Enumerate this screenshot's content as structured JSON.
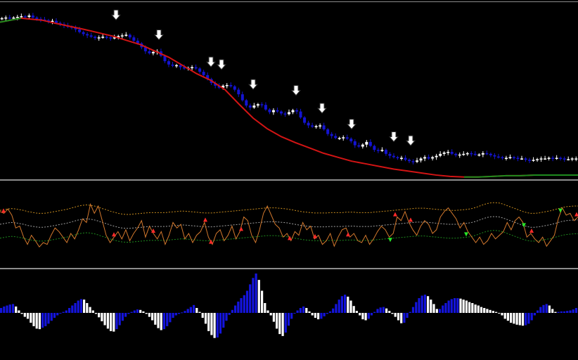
{
  "colors": {
    "background": "#000000",
    "separator": "#8c8c8c",
    "bull_candle": "#ffffff",
    "bear_candle": "#1414d2",
    "trend_down": "#d21414",
    "trend_up": "#1e8c1e",
    "oscillator": "#d2782d",
    "band_upper": "#c88c1e",
    "band_mid": "#a0a0a0",
    "band_lower": "#1e8c1e",
    "signal_high": "#ff2a2a",
    "signal_low": "#28e628",
    "hist_pos": "#1414dc",
    "hist_neg": "#ffffff",
    "arrow_fill": "#ffffff",
    "arrow_stroke": "#000000"
  },
  "icons": {
    "sell_signal": "down-arrow-icon"
  },
  "chart_data": [
    {
      "type": "candlestick",
      "ylim": [
        0,
        255
      ],
      "grid": false,
      "closes": [
        236,
        237,
        236,
        237,
        238,
        239,
        238,
        240,
        237,
        235,
        234,
        233,
        231,
        232,
        229,
        227,
        225,
        223,
        222,
        219,
        215,
        212,
        210,
        208,
        206,
        207,
        208,
        207,
        206,
        207,
        209,
        210,
        211,
        207,
        202,
        198,
        192,
        186,
        183,
        185,
        186,
        179,
        171,
        166,
        164,
        165,
        162,
        160,
        161,
        162,
        160,
        155,
        150,
        144,
        138,
        134,
        131,
        134,
        135,
        133,
        128,
        121,
        112,
        104,
        101,
        104,
        106,
        105,
        98,
        94,
        97,
        95,
        92,
        91,
        94,
        97,
        95,
        86,
        78,
        74,
        72,
        73,
        74,
        68,
        61,
        58,
        55,
        55,
        56,
        54,
        50,
        44,
        42,
        45,
        49,
        43,
        37,
        36,
        37,
        31,
        28,
        26,
        25,
        25,
        22,
        20,
        19,
        21,
        24,
        26,
        24,
        26,
        28,
        31,
        33,
        34,
        31,
        29,
        30,
        31,
        32,
        31,
        30,
        30,
        32,
        31,
        29,
        27,
        26,
        25,
        25,
        26,
        25,
        24,
        24,
        22,
        21,
        22,
        23,
        24,
        24,
        25,
        24,
        25,
        24,
        23,
        23,
        24,
        24
      ],
      "trend_line": [
        [
          0,
          230
        ],
        [
          30,
          236
        ],
        [
          60,
          233
        ],
        [
          80,
          228
        ],
        [
          120,
          219
        ],
        [
          160,
          209
        ],
        [
          200,
          196
        ],
        [
          240,
          177
        ],
        [
          280,
          152
        ],
        [
          300,
          142
        ],
        [
          320,
          128
        ],
        [
          340,
          106
        ],
        [
          360,
          85
        ],
        [
          380,
          69
        ],
        [
          400,
          57
        ],
        [
          420,
          48
        ],
        [
          440,
          40
        ],
        [
          460,
          32
        ],
        [
          480,
          26
        ],
        [
          500,
          20
        ],
        [
          520,
          16
        ],
        [
          540,
          12
        ],
        [
          560,
          8
        ],
        [
          580,
          5
        ],
        [
          600,
          2
        ],
        [
          620,
          -1
        ],
        [
          640,
          -3
        ],
        [
          660,
          -4
        ],
        [
          680,
          -4
        ],
        [
          700,
          -3
        ],
        [
          720,
          -2
        ],
        [
          740,
          -2
        ],
        [
          760,
          -1
        ],
        [
          780,
          -1
        ],
        [
          800,
          -1
        ],
        [
          822,
          -1
        ]
      ],
      "trend_up_ranges": [
        [
          0,
          55
        ],
        [
          655,
          822
        ]
      ],
      "signal_arrows_x": [
        165,
        226,
        300,
        315,
        360,
        421,
        458,
        500,
        560,
        584
      ]
    },
    {
      "type": "line",
      "ylim": [
        -1,
        1
      ],
      "grid": false,
      "oscillator": [
        0.35,
        0.3,
        0.42,
        0.25,
        -0.1,
        -0.05,
        -0.35,
        -0.55,
        -0.3,
        -0.45,
        -0.62,
        -0.5,
        -0.55,
        -0.3,
        -0.1,
        -0.2,
        -0.35,
        -0.5,
        -0.25,
        -0.4,
        -0.15,
        0.15,
        0.05,
        0.55,
        0.3,
        0.5,
        0.1,
        -0.3,
        -0.5,
        -0.35,
        -0.2,
        -0.4,
        -0.15,
        -0.45,
        -0.25,
        -0.1,
        0.1,
        -0.35,
        -0.05,
        -0.25,
        -0.4,
        -0.2,
        -0.55,
        -0.3,
        0.05,
        -0.1,
        0.0,
        -0.4,
        -0.25,
        -0.5,
        -0.3,
        -0.2,
        0.05,
        -0.35,
        -0.55,
        -0.25,
        -0.15,
        -0.45,
        -0.3,
        -0.05,
        -0.4,
        -0.2,
        0.2,
        0.1,
        -0.3,
        -0.5,
        -0.15,
        0.3,
        0.5,
        0.25,
        0.0,
        -0.1,
        -0.35,
        -0.25,
        -0.45,
        -0.2,
        -0.3,
        0.05,
        -0.15,
        -0.05,
        -0.4,
        -0.3,
        -0.55,
        -0.45,
        -0.25,
        -0.6,
        -0.35,
        -0.15,
        -0.1,
        -0.35,
        -0.25,
        -0.45,
        -0.5,
        -0.3,
        -0.55,
        -0.4,
        -0.2,
        -0.05,
        -0.15,
        -0.35,
        -0.25,
        0.2,
        0.1,
        0.35,
        0.05,
        -0.15,
        -0.3,
        -0.05,
        0.1,
        0.0,
        -0.25,
        -0.15,
        0.2,
        0.35,
        0.45,
        0.3,
        0.15,
        -0.1,
        0.05,
        -0.2,
        -0.35,
        -0.5,
        -0.35,
        -0.55,
        -0.45,
        -0.25,
        -0.4,
        -0.3,
        -0.2,
        0.05,
        -0.15,
        0.1,
        0.2,
        0.05,
        -0.35,
        -0.25,
        -0.4,
        -0.5,
        -0.35,
        -0.6,
        -0.45,
        -0.3,
        0.15,
        0.45,
        0.25,
        0.3,
        0.1,
        0.2
      ],
      "mid_band": [
        0.0,
        0.02,
        0.04,
        0.05,
        0.04,
        0.02,
        0.0,
        -0.03,
        -0.05,
        -0.07,
        -0.08,
        -0.08,
        -0.07,
        -0.05,
        -0.03,
        -0.01,
        0.01,
        0.03,
        0.06,
        0.09,
        0.12,
        0.14,
        0.15,
        0.14,
        0.12,
        0.09,
        0.05,
        0.02,
        -0.02,
        -0.05,
        -0.08,
        -0.1,
        -0.11,
        -0.11,
        -0.1,
        -0.09,
        -0.08,
        -0.07,
        -0.06,
        -0.06,
        -0.06,
        -0.06,
        -0.06,
        -0.05,
        -0.04,
        -0.03,
        -0.02,
        -0.02,
        -0.03,
        -0.04,
        -0.05,
        -0.06,
        -0.07,
        -0.07,
        -0.07,
        -0.06,
        -0.05,
        -0.04,
        -0.03,
        -0.02,
        -0.01,
        0.0,
        0.01,
        0.02,
        0.03,
        0.04,
        0.05,
        0.06,
        0.07,
        0.07,
        0.07,
        0.06,
        0.05,
        0.04,
        0.02,
        0.0,
        -0.02,
        -0.04,
        -0.05,
        -0.06,
        -0.07,
        -0.07,
        -0.07,
        -0.07,
        -0.06,
        -0.06,
        -0.06,
        -0.06,
        -0.05,
        -0.05,
        -0.05,
        -0.06,
        -0.06,
        -0.06,
        -0.06,
        -0.05,
        -0.04,
        -0.03,
        -0.02,
        -0.01,
        0.0,
        0.01,
        0.02,
        0.03,
        0.04,
        0.05,
        0.06,
        0.06,
        0.06,
        0.05,
        0.04,
        0.03,
        0.02,
        0.01,
        0.0,
        0.0,
        0.0,
        0.01,
        0.02,
        0.03,
        0.05,
        0.08,
        0.12,
        0.16,
        0.19,
        0.21,
        0.21,
        0.2,
        0.17,
        0.13,
        0.09,
        0.05,
        0.01,
        -0.03,
        -0.06,
        -0.08,
        -0.08,
        -0.07,
        -0.05,
        -0.03,
        -0.01,
        0.02,
        0.05,
        0.08,
        0.1,
        0.11,
        0.12,
        0.12
      ],
      "band_width": 0.38,
      "high_signals_x": [
        5,
        162,
        218,
        292,
        300,
        343,
        412,
        448,
        495,
        562,
        584,
        756,
        820
      ],
      "low_signals_x": [
        555,
        663,
        745,
        797
      ]
    },
    {
      "type": "bar",
      "ylim": [
        -1,
        1
      ],
      "grid": false,
      "histogram": [
        0.1,
        0.13,
        0.15,
        0.17,
        0.18,
        0.13,
        0.05,
        -0.02,
        -0.08,
        -0.12,
        -0.2,
        -0.27,
        -0.32,
        -0.33,
        -0.3,
        -0.27,
        -0.22,
        -0.16,
        -0.1,
        -0.05,
        -0.01,
        0.02,
        0.05,
        0.1,
        0.15,
        0.2,
        0.25,
        0.28,
        0.27,
        0.2,
        0.12,
        0.05,
        -0.02,
        -0.09,
        -0.17,
        -0.25,
        -0.32,
        -0.37,
        -0.38,
        -0.33,
        -0.25,
        -0.16,
        -0.08,
        -0.02,
        0.02,
        0.05,
        0.07,
        0.06,
        0.03,
        -0.02,
        -0.08,
        -0.15,
        -0.24,
        -0.31,
        -0.35,
        -0.33,
        -0.27,
        -0.19,
        -0.1,
        -0.05,
        -0.02,
        0.01,
        0.04,
        0.08,
        0.12,
        0.16,
        0.1,
        0.02,
        -0.1,
        -0.22,
        -0.37,
        -0.45,
        -0.51,
        -0.5,
        -0.42,
        -0.3,
        -0.16,
        -0.04,
        0.06,
        0.15,
        0.23,
        0.3,
        0.36,
        0.45,
        0.58,
        0.71,
        0.8,
        0.67,
        0.45,
        0.2,
        0.05,
        -0.05,
        -0.18,
        -0.32,
        -0.43,
        -0.47,
        -0.4,
        -0.26,
        -0.12,
        0.0,
        0.05,
        0.1,
        0.13,
        0.1,
        0.03,
        -0.05,
        -0.1,
        -0.13,
        -0.12,
        -0.07,
        -0.02,
        0.03,
        0.09,
        0.18,
        0.27,
        0.34,
        0.37,
        0.33,
        0.25,
        0.14,
        0.04,
        -0.05,
        -0.13,
        -0.15,
        -0.12,
        -0.05,
        0.02,
        0.08,
        0.11,
        0.12,
        0.09,
        0.04,
        -0.02,
        -0.08,
        -0.15,
        -0.21,
        -0.2,
        -0.1,
        0.02,
        0.12,
        0.22,
        0.3,
        0.35,
        0.37,
        0.34,
        0.27,
        0.18,
        0.08
      ],
      "histogram_tail": [
        0.08,
        0.15,
        0.2,
        0.25,
        0.28,
        0.3,
        0.3,
        0.29,
        0.27,
        0.25,
        0.22,
        0.2,
        0.17,
        0.15,
        0.12,
        0.1,
        0.08,
        0.06,
        0.04,
        0.02,
        0.0,
        -0.05,
        -0.12,
        -0.16,
        -0.2,
        -0.22,
        -0.24,
        -0.25,
        -0.26,
        -0.25,
        -0.22,
        -0.15,
        -0.05,
        0.05,
        0.12,
        0.16,
        0.18,
        0.15,
        0.08,
        0.02,
        0.02,
        0.03,
        0.03,
        0.04,
        0.05,
        0.07,
        0.1
      ]
    }
  ]
}
